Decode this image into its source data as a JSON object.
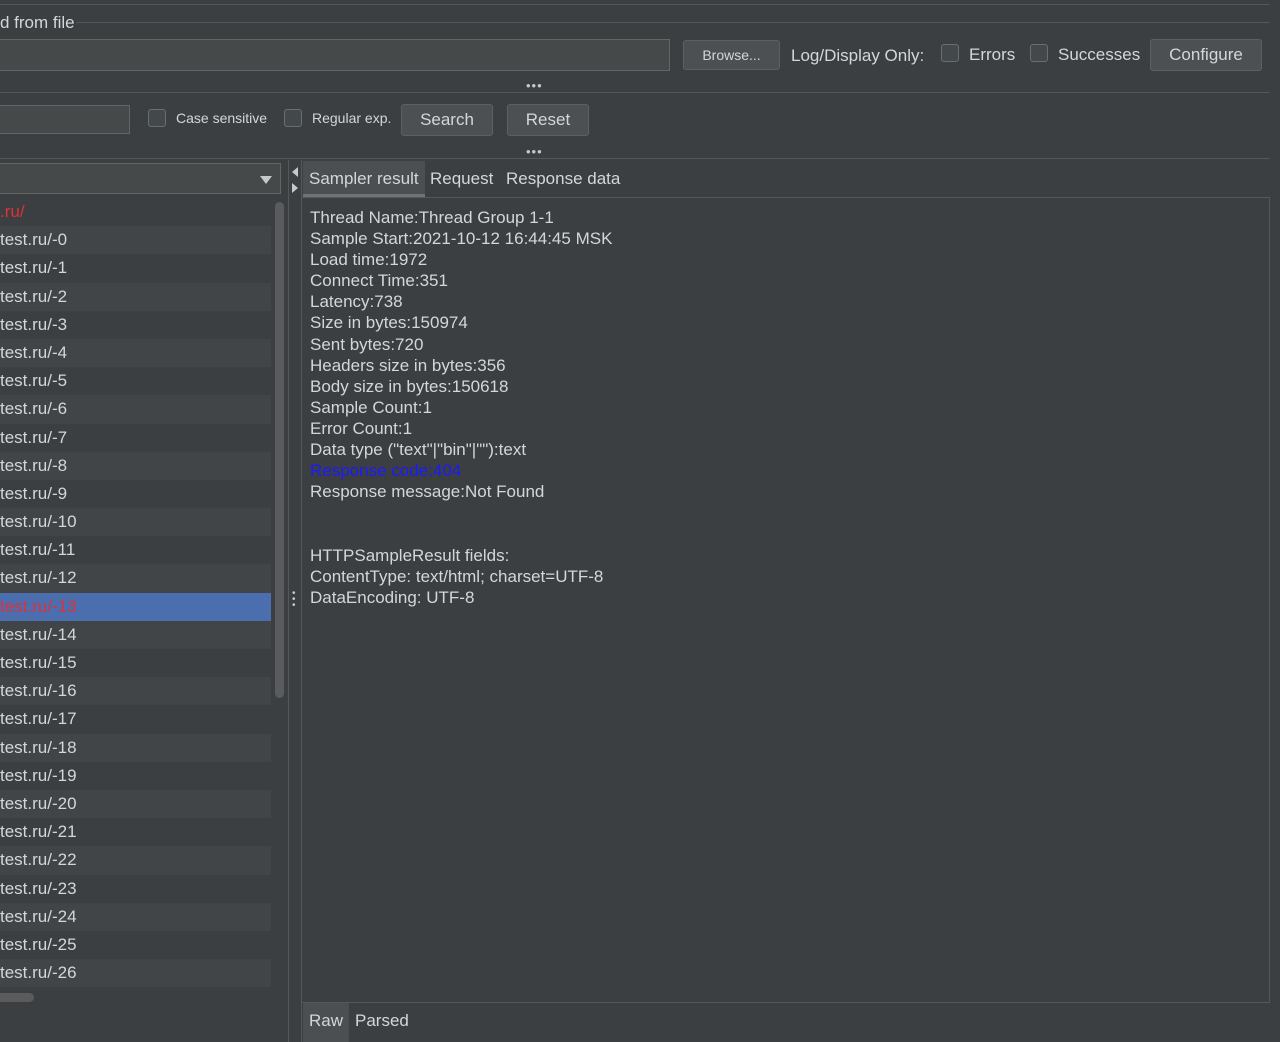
{
  "file_section": {
    "legend": "d from file",
    "browse_label": "Browse...",
    "log_display_label": "Log/Display Only:",
    "errors_label": "Errors",
    "successes_label": "Successes",
    "configure_label": "Configure"
  },
  "search_bar": {
    "case_sensitive_label": "Case sensitive",
    "regex_label": "Regular exp.",
    "search_label": "Search",
    "reset_label": "Reset"
  },
  "tree": {
    "items": [
      {
        "label": ".ru/",
        "error": true
      },
      {
        "label": "test.ru/-0"
      },
      {
        "label": "test.ru/-1"
      },
      {
        "label": "test.ru/-2"
      },
      {
        "label": "test.ru/-3"
      },
      {
        "label": "test.ru/-4"
      },
      {
        "label": "test.ru/-5"
      },
      {
        "label": "test.ru/-6"
      },
      {
        "label": "test.ru/-7"
      },
      {
        "label": "test.ru/-8"
      },
      {
        "label": "test.ru/-9"
      },
      {
        "label": "test.ru/-10"
      },
      {
        "label": "test.ru/-11"
      },
      {
        "label": "test.ru/-12"
      },
      {
        "label": "test.ru/-13",
        "error": true,
        "selected": true
      },
      {
        "label": "test.ru/-14"
      },
      {
        "label": "test.ru/-15"
      },
      {
        "label": "test.ru/-16"
      },
      {
        "label": "test.ru/-17"
      },
      {
        "label": "test.ru/-18"
      },
      {
        "label": "test.ru/-19"
      },
      {
        "label": "test.ru/-20"
      },
      {
        "label": "test.ru/-21"
      },
      {
        "label": "test.ru/-22"
      },
      {
        "label": "test.ru/-23"
      },
      {
        "label": "test.ru/-24"
      },
      {
        "label": "test.ru/-25"
      },
      {
        "label": "test.ru/-26"
      }
    ]
  },
  "tabs": {
    "sampler_result": "Sampler result",
    "request": "Request",
    "response_data": "Response data"
  },
  "result": {
    "lines": [
      {
        "text": "Thread Name:Thread Group 1-1"
      },
      {
        "text": "Sample Start:2021-10-12 16:44:45 MSK"
      },
      {
        "text": "Load time:1972"
      },
      {
        "text": "Connect Time:351"
      },
      {
        "text": "Latency:738"
      },
      {
        "text": "Size in bytes:150974"
      },
      {
        "text": "Sent bytes:720"
      },
      {
        "text": "Headers size in bytes:356"
      },
      {
        "text": "Body size in bytes:150618"
      },
      {
        "text": "Sample Count:1"
      },
      {
        "text": "Error Count:1"
      },
      {
        "text": "Data type (\"text\"|\"bin\"|\"\"):text"
      },
      {
        "text": "Response code:404",
        "highlight": true
      },
      {
        "text": "Response message:Not Found"
      },
      {
        "text": ""
      },
      {
        "text": ""
      },
      {
        "text": "HTTPSampleResult fields:"
      },
      {
        "text": "ContentType: text/html; charset=UTF-8"
      },
      {
        "text": "DataEncoding: UTF-8"
      }
    ]
  },
  "bottom_tabs": {
    "raw": "Raw",
    "parsed": "Parsed"
  },
  "colors": {
    "background": "#3c3f41",
    "selection": "#4b6eaf",
    "error_text": "#e0303a",
    "response_code": "#1a1aff"
  }
}
